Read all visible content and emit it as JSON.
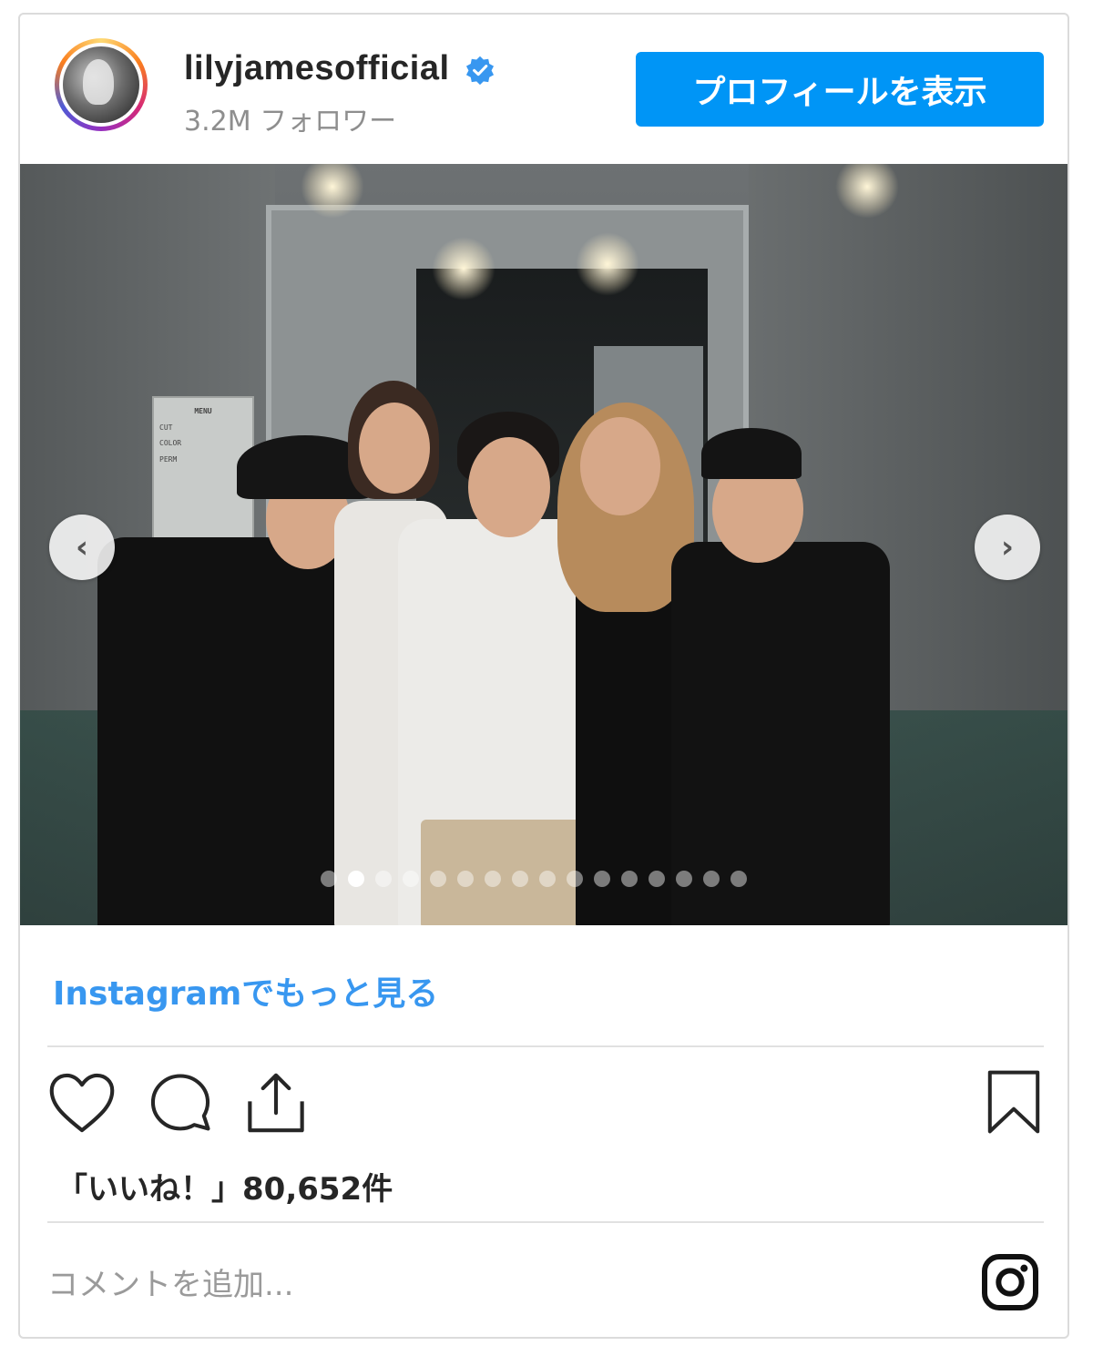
{
  "post": {
    "username": "lilyjamesofficial",
    "followers": "3.2M フォロワー",
    "profile_button_label": "プロフィールを表示",
    "more_link_label": "Instagramでもっと見る",
    "likes_text": "「いいね！」80,652件",
    "comment_placeholder": "コメントを追加..."
  },
  "sign": {
    "title": "MENU",
    "lines": [
      "CUT",
      "COLOR",
      "PERM"
    ]
  },
  "carousel": {
    "total_slides": 16,
    "active_index": 2
  },
  "colors": {
    "accent": "#0095f6",
    "link": "#3897f0",
    "verified": "#3897f0"
  },
  "icons": [
    "verified-badge-icon",
    "chevron-left-icon",
    "chevron-right-icon",
    "heart-icon",
    "comment-icon",
    "share-icon",
    "bookmark-icon",
    "instagram-icon"
  ]
}
